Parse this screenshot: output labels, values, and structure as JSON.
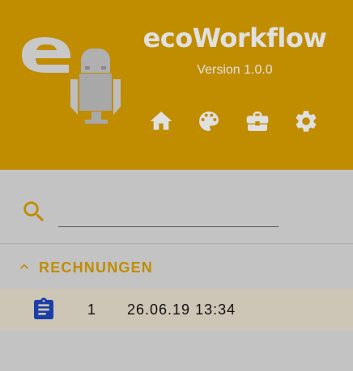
{
  "app": {
    "title": "ecoWorkflow",
    "version": "Version 1.0.0"
  },
  "nav": {
    "icons": [
      "home-icon",
      "palette-icon",
      "briefcase-icon",
      "settings-gear-icon"
    ]
  },
  "search": {
    "placeholder": "",
    "value": ""
  },
  "section": {
    "label": "RECHNUNGEN",
    "expanded": true
  },
  "list": {
    "items": [
      {
        "icon": "clipboard-icon",
        "number": "1",
        "datetime": "26.06.19 13:34"
      }
    ]
  },
  "colors": {
    "accent": "#c08c00",
    "background": "#c3c3c3",
    "row_highlight": "#cdc6b6",
    "clipboard_icon": "#1a3fa8"
  }
}
